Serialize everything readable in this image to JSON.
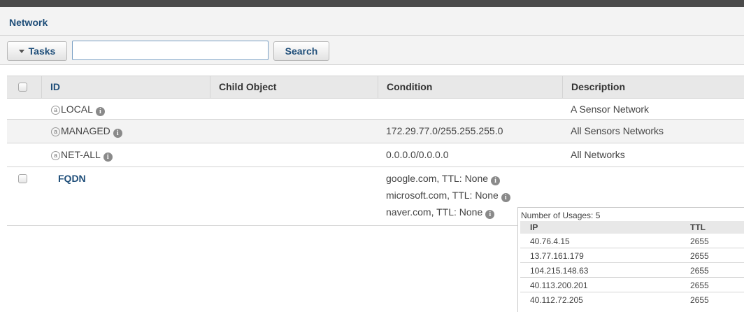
{
  "page": {
    "title": "Network"
  },
  "toolbar": {
    "tasks_label": "Tasks",
    "search_value": "",
    "search_label": "Search"
  },
  "table": {
    "columns": [
      "ID",
      "Child Object",
      "Condition",
      "Description"
    ],
    "rows": [
      {
        "id": "LOCAL",
        "child": "",
        "condition": "",
        "description": "A Sensor Network"
      },
      {
        "id": "MANAGED",
        "child": "",
        "condition": "172.29.77.0/255.255.255.0",
        "description": "All Sensors Networks"
      },
      {
        "id": "NET-ALL",
        "child": "",
        "condition": "0.0.0.0/0.0.0.0",
        "description": "All Networks"
      }
    ],
    "fqdn": {
      "id": "FQDN",
      "conditions": [
        "google.com, TTL: None",
        "microsoft.com, TTL: None",
        "naver.com, TTL: None"
      ]
    }
  },
  "popup": {
    "usage": "Number of Usages: 5",
    "columns": [
      "IP",
      "TTL"
    ],
    "rows": [
      {
        "ip": "40.76.4.15",
        "ttl": "2655"
      },
      {
        "ip": "13.77.161.179",
        "ttl": "2655"
      },
      {
        "ip": "104.215.148.63",
        "ttl": "2655"
      },
      {
        "ip": "40.113.200.201",
        "ttl": "2655"
      },
      {
        "ip": "40.112.72.205",
        "ttl": "2655"
      }
    ]
  },
  "colors": {
    "accent": "#1f4e79",
    "header_bg": "#e8e8e8",
    "alt_row": "#f3f3f3",
    "topbar": "#4a4a4a"
  },
  "icons": [
    "caret-down-icon",
    "info-icon",
    "address-object-icon",
    "checkbox"
  ]
}
